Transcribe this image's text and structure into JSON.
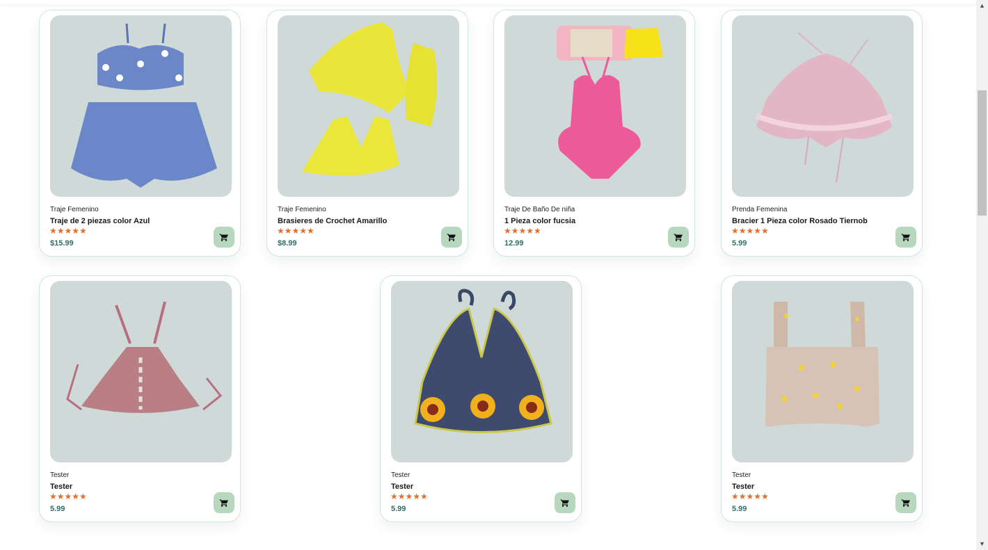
{
  "products": [
    {
      "category": "Traje Femenino",
      "name": "Traje de 2 piezas color Azul",
      "stars": "★★★★★",
      "price": "$15.99",
      "rating": 5
    },
    {
      "category": "Traje Femenino",
      "name": "Brasieres de Crochet Amarillo",
      "stars": "★★★★★",
      "price": "$8.99",
      "rating": 5
    },
    {
      "category": "Traje De Baño De niña",
      "name": "1 Pieza color fucsia",
      "stars": "★★★★★",
      "price": "12.99",
      "rating": 5
    },
    {
      "category": "Prenda Femenina",
      "name": "Bracier 1 Pieza color Rosado Tiernob",
      "stars": "★★★★★",
      "price": "5.99",
      "rating": 5
    },
    {
      "category": "Tester",
      "name": "Tester",
      "stars": "★★★★★",
      "price": "5.99",
      "rating": 5
    },
    {
      "category": "Tester",
      "name": "Tester",
      "stars": "★★★★★",
      "price": "5.99",
      "rating": 5
    },
    {
      "category": "Tester",
      "name": "Tester",
      "stars": "★★★★★",
      "price": "5.99",
      "rating": 5
    }
  ],
  "colors": {
    "card_border": "#cfe6dc",
    "image_bg": "#cfd9d8",
    "star": "#e0702a",
    "price": "#2e6e68",
    "cart_button": "#b8d7bf"
  },
  "icons": {
    "cart": "cart-icon"
  }
}
